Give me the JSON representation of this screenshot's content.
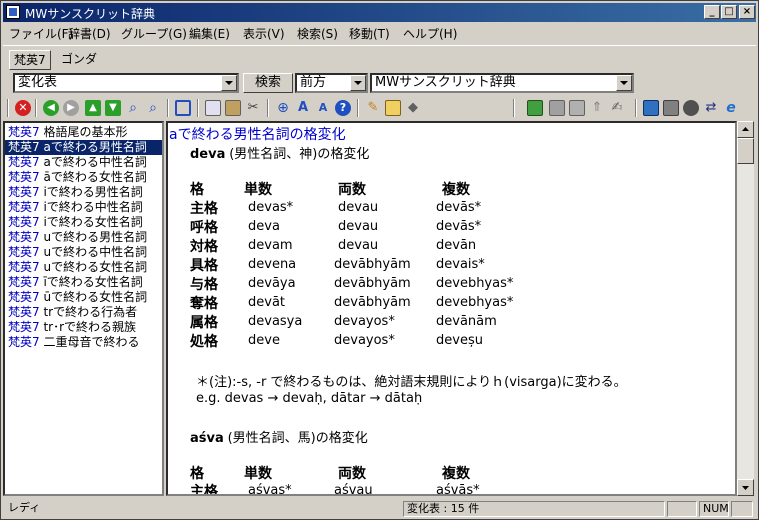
{
  "window": {
    "title": "MWサンスクリット辞典"
  },
  "menu": [
    "ファイル(F)",
    "辞書(D)",
    "グループ(G)",
    "編集(E)",
    "表示(V)",
    "検索(S)",
    "移動(T)",
    "ヘルプ(H)"
  ],
  "tabs": [
    "梵英7",
    "ゴンダ"
  ],
  "search": {
    "query_value": "変化表",
    "search_button": "検索",
    "mode_value": "前方",
    "dictionary_value": "MWサンスクリット辞典"
  },
  "list": {
    "tag": "梵英7",
    "items": [
      "格語尾の基本形",
      "aで終わる男性名詞",
      "aで終わる中性名詞",
      "āで終わる女性名詞",
      "iで終わる男性名詞",
      "iで終わる中性名詞",
      "iで終わる女性名詞",
      "uで終わる男性名詞",
      "uで終わる中性名詞",
      "uで終わる女性名詞",
      "īで終わる女性名詞",
      "ūで終わる女性名詞",
      "trで終わる行為者",
      "tr･rで終わる親族",
      "二重母音で終わる"
    ],
    "selected_index": 1
  },
  "content": {
    "heading": "aで終わる男性名詞の格変化",
    "section1": {
      "word": "deva",
      "desc": "(男性名詞、神)の格変化",
      "headers": [
        "格",
        "単数",
        "両数",
        "複数"
      ],
      "rows": [
        [
          "主格",
          "devas*",
          "devau",
          "devās*"
        ],
        [
          "呼格",
          "deva",
          "devau",
          "devās*"
        ],
        [
          "対格",
          "devam",
          "devau",
          "devān"
        ],
        [
          "具格",
          "devena",
          "devābhyām",
          "devais*"
        ],
        [
          "与格",
          "devāya",
          "devābhyām",
          "devebhyas*"
        ],
        [
          "奪格",
          "devāt",
          "devābhyām",
          "devebhyas*"
        ],
        [
          "属格",
          "devasya",
          "devayos*",
          "devānām"
        ],
        [
          "処格",
          "deve",
          "devayos*",
          "deveșu"
        ]
      ]
    },
    "note": "＊(注):-s, -r で終わるものは、絶対語末規則によりｈ(visarga)に変わる。",
    "example": "e.g. devas → devaḥ, dātar → dātaḥ",
    "section2": {
      "word": "aśva",
      "desc": "(男性名詞、馬)の格変化",
      "headers": [
        "格",
        "単数",
        "両数",
        "複数"
      ],
      "rows": [
        [
          "主格",
          "aśvas*",
          "aśvau",
          "aśvās*"
        ]
      ]
    }
  },
  "status": {
    "ready": "レディ",
    "count": "変化表 : 15 件",
    "num": "NUM"
  }
}
